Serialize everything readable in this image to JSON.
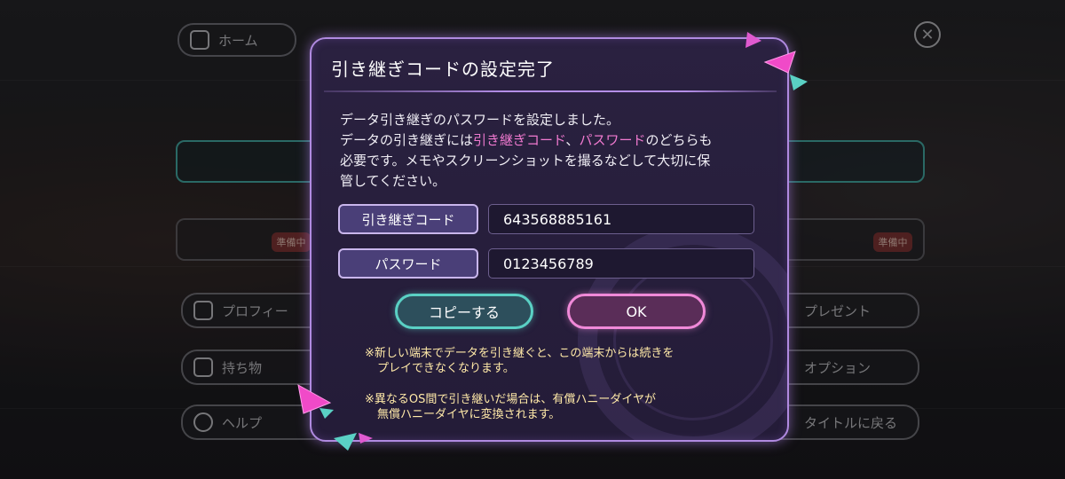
{
  "background": {
    "home_label": "ホーム",
    "profile_label": "プロフィー",
    "items_label": "持ち物",
    "help_label": "ヘルプ",
    "present_label": "プレゼント",
    "option_label": "オプション",
    "return_title_label": "タイトルに戻る",
    "preparing_badge_1": "準備中",
    "preparing_badge_2": "準備中"
  },
  "dialog": {
    "title": "引き継ぎコードの設定完了",
    "message_line1": "データ引き継ぎのパスワードを設定しました。",
    "message_line2_prefix": "データの引き継ぎには",
    "message_line2_code": "引き継ぎコード",
    "message_line2_sep": "、",
    "message_line2_password": "パスワード",
    "message_line2_suffix": "のどちらも",
    "message_line3": "必要です。メモやスクリーンショットを撮るなどして大切に保",
    "message_line4": "管してください。",
    "code_label": "引き継ぎコード",
    "code_value": "643568885161",
    "password_label": "パスワード",
    "password_value": "0123456789",
    "copy_button": "コピーする",
    "ok_button": "OK",
    "note1_line1": "※新しい端末でデータを引き継ぐと、この端末からは続きを",
    "note1_line2": "プレイできなくなります。",
    "note2_line1": "※異なるOS間で引き継いだ場合は、有償ハニーダイヤが",
    "note2_line2": "無償ハニーダイヤに変換されます。"
  },
  "colors": {
    "dialog_border": "#b08ae0",
    "highlight": "#f07ad0",
    "copy_button_border": "#5ad0c4",
    "ok_button_border": "#f089d8",
    "note_text": "#ffe9a8"
  }
}
